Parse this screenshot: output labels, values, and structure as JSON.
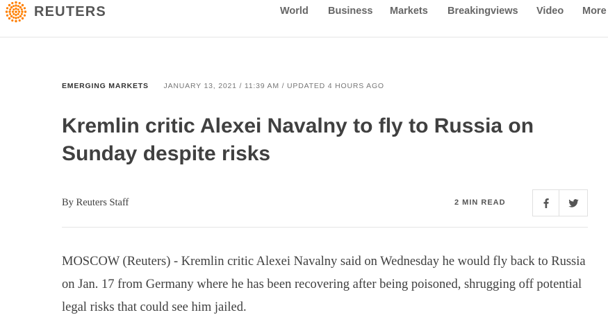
{
  "brand": {
    "name": "REUTERS",
    "accent_color": "#ff8000"
  },
  "nav": {
    "items": [
      "World",
      "Business",
      "Markets",
      "Breakingviews",
      "Video",
      "More"
    ]
  },
  "article": {
    "section": "EMERGING MARKETS",
    "dateline": "JANUARY 13, 2021 / 11:39 AM / UPDATED 4 HOURS AGO",
    "headline": "Kremlin critic Alexei Navalny to fly to Russia on Sunday despite risks",
    "byline_prefix": "By ",
    "byline_author": "Reuters Staff",
    "read_time": "2 MIN READ",
    "share": {
      "facebook_icon": "facebook-icon",
      "twitter_icon": "twitter-icon"
    },
    "lead": "MOSCOW (Reuters) - Kremlin critic Alexei Navalny said on Wednesday he would fly back to Russia on Jan. 17 from Germany where he has been recovering after being poisoned, shrugging off potential legal risks that could see him jailed."
  }
}
